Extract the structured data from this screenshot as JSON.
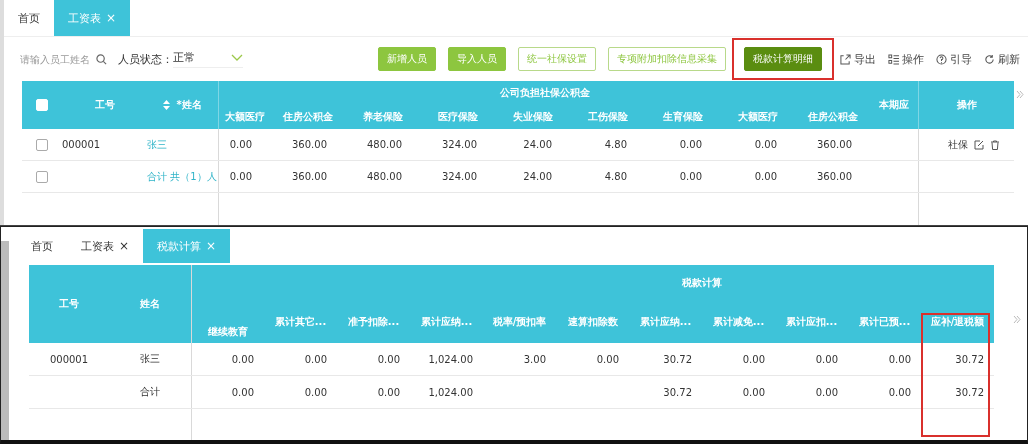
{
  "top": {
    "tabs": [
      {
        "label": "首页",
        "selected": false
      },
      {
        "label": "工资表",
        "selected": true,
        "close": "×"
      }
    ],
    "search": {
      "placeholder": "请输入员工姓名"
    },
    "status_filter": {
      "label": "人员状态：",
      "value": "正常"
    },
    "buttons": [
      {
        "label": "新增人员",
        "kind": "filled",
        "highlighted": false
      },
      {
        "label": "导入人员",
        "kind": "filled",
        "highlighted": false
      },
      {
        "label": "统一社保设置",
        "kind": "outline",
        "highlighted": false
      },
      {
        "label": "专项附加扣除信息采集",
        "kind": "outline",
        "highlighted": false
      },
      {
        "label": "税款计算明细",
        "kind": "dark",
        "highlighted": true
      }
    ],
    "tools": [
      {
        "label": "导出",
        "kind": "export"
      },
      {
        "label": "操作",
        "kind": "columns"
      },
      {
        "label": "引导",
        "kind": "help"
      },
      {
        "label": "刷新",
        "kind": "refresh"
      }
    ],
    "table": {
      "select_all": {
        "checked": false
      },
      "id_header": "工号",
      "name_header": "*姓名",
      "group_header": "公司负担社保公积金",
      "columns": [
        "大额医疗",
        "住房公积金",
        "养老保险",
        "医疗保险",
        "失业保险",
        "工伤保险",
        "生育保险",
        "大额医疗",
        "住房公积金"
      ],
      "period_header": "本期应",
      "ops_header": "操作",
      "rows": [
        {
          "checked": false,
          "id": "000001",
          "name": "张三",
          "values": [
            "0.00",
            "360.00",
            "480.00",
            "324.00",
            "24.00",
            "4.80",
            "0.00",
            "0.00",
            "360.00"
          ],
          "ops": "社保"
        },
        {
          "checked": false,
          "name": "合计 共（1）人",
          "values": [
            "0.00",
            "360.00",
            "480.00",
            "324.00",
            "24.00",
            "4.80",
            "0.00",
            "0.00",
            "360.00"
          ]
        }
      ]
    }
  },
  "bottom": {
    "tabs": [
      {
        "label": "首页",
        "selected": false
      },
      {
        "label": "工资表",
        "selected": false,
        "close": "×"
      },
      {
        "label": "税款计算",
        "selected": true,
        "close": "×"
      }
    ],
    "table": {
      "id_header": "工号",
      "name_header": "姓名",
      "group_header": "税款计算",
      "columns": [
        {
          "label": "继续教育",
          "highlighted": false
        },
        {
          "label": "累计其它...",
          "highlighted": false
        },
        {
          "label": "准予扣除...",
          "highlighted": false
        },
        {
          "label": "累计应纳...",
          "highlighted": false
        },
        {
          "label": "税率/预扣率",
          "highlighted": false
        },
        {
          "label": "速算扣除数",
          "highlighted": false
        },
        {
          "label": "累计应纳...",
          "highlighted": false
        },
        {
          "label": "累计减免...",
          "highlighted": false
        },
        {
          "label": "累计应扣...",
          "highlighted": false
        },
        {
          "label": "累计已预...",
          "highlighted": false
        },
        {
          "label": "应补/退税额",
          "highlighted": true
        }
      ],
      "rows": [
        {
          "id": "000001",
          "name": "张三",
          "cells": [
            {
              "kind": "value",
              "text": "0.00"
            },
            {
              "kind": "value",
              "text": "0.00"
            },
            {
              "kind": "value",
              "text": "0.00"
            },
            {
              "kind": "value",
              "text": "1,024.00"
            },
            {
              "kind": "value",
              "text": "3.00"
            },
            {
              "kind": "value",
              "text": "0.00"
            },
            {
              "kind": "value",
              "text": "30.72"
            },
            {
              "kind": "value",
              "text": "0.00"
            },
            {
              "kind": "value",
              "text": "0.00"
            },
            {
              "kind": "value",
              "text": "0.00"
            },
            {
              "kind": "value",
              "text": "30.72"
            }
          ]
        },
        {
          "name": "合计",
          "cells": [
            {
              "kind": "value",
              "text": "0.00"
            },
            {
              "kind": "value",
              "text": "0.00"
            },
            {
              "kind": "value",
              "text": "0.00"
            },
            {
              "kind": "value",
              "text": "1,024.00"
            },
            {
              "kind": "blank"
            },
            {
              "kind": "blank"
            },
            {
              "kind": "value",
              "text": "30.72"
            },
            {
              "kind": "value",
              "text": "0.00"
            },
            {
              "kind": "value",
              "text": "0.00"
            },
            {
              "kind": "value",
              "text": "0.00"
            },
            {
              "kind": "value",
              "text": "30.72"
            }
          ]
        }
      ]
    }
  }
}
